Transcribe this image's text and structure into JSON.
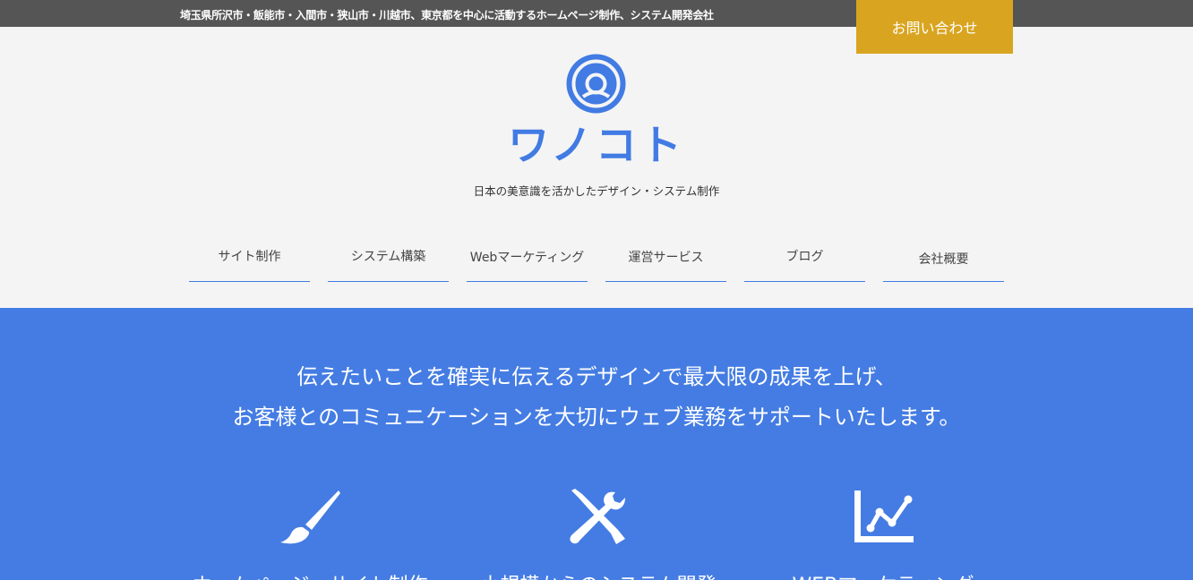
{
  "topbar": {
    "text": "埼玉県所沢市・飯能市・入間市・狭山市・川越市、東京都を中心に活動するホームページ制作、システム開発会社",
    "contact_label": "お問い合わせ"
  },
  "logo": {
    "name": "ワノコト",
    "tagline": "日本の美意識を活かしたデザイン・システム制作",
    "color": "#417be3"
  },
  "nav": {
    "items": [
      {
        "label": "サイト制作"
      },
      {
        "label": "システム構築"
      },
      {
        "label": "Webマーケティング"
      },
      {
        "label": "運営サービス"
      },
      {
        "label": "ブログ"
      },
      {
        "label": "会社概要"
      }
    ]
  },
  "hero": {
    "line1": "伝えたいことを確実に伝えるデザインで最大限の成果を上げ、",
    "line2": "お客様とのコミュニケーションを大切にウェブ業務をサポートいたします。",
    "background": "#447ce3",
    "services": [
      {
        "icon": "paintbrush-icon",
        "title": "ホームページ・サイト制作"
      },
      {
        "icon": "tools-icon",
        "title": "小規模からのシステム開発"
      },
      {
        "icon": "chart-line-icon",
        "title": "WEBマーケティング"
      }
    ]
  },
  "colors": {
    "topbar": "#555555",
    "contact_button": "#d9a521",
    "accent": "#417be3",
    "page_background": "#f4f4f4"
  }
}
